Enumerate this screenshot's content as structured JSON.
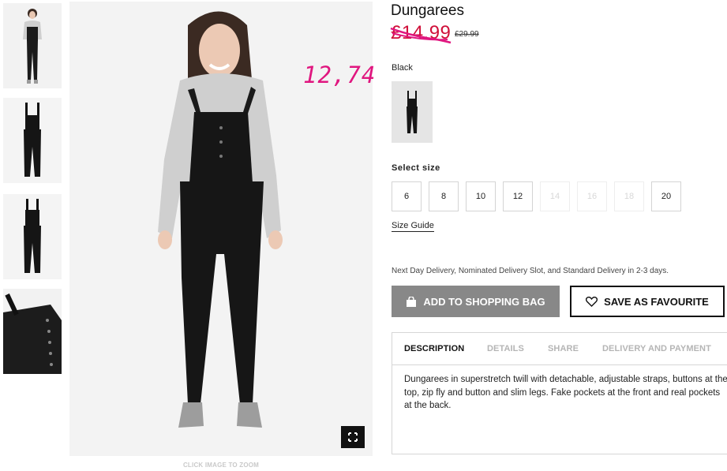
{
  "gallery": {
    "zoom_hint": "CLICK IMAGE TO ZOOM"
  },
  "annotation": "12,74",
  "product": {
    "title": "Dungarees",
    "price_sale": "£14.99",
    "price_original": "£29.99",
    "color_label": "Black",
    "size_label": "Select size",
    "sizes": [
      {
        "label": "6",
        "available": true
      },
      {
        "label": "8",
        "available": true
      },
      {
        "label": "10",
        "available": true
      },
      {
        "label": "12",
        "available": true
      },
      {
        "label": "14",
        "available": false
      },
      {
        "label": "16",
        "available": false
      },
      {
        "label": "18",
        "available": false
      },
      {
        "label": "20",
        "available": true
      }
    ],
    "size_guide": "Size Guide",
    "delivery": "Next Day Delivery, Nominated Delivery Slot, and Standard Delivery in 2-3 days."
  },
  "actions": {
    "add_to_bag": "ADD TO SHOPPING BAG",
    "save_favourite": "SAVE AS FAVOURITE",
    "bag_icon": "shopping-bag-icon",
    "heart_icon": "heart-icon"
  },
  "tabs": {
    "items": [
      "DESCRIPTION",
      "DETAILS",
      "SHARE",
      "DELIVERY AND PAYMENT"
    ],
    "active": "DESCRIPTION",
    "description_text": "Dungarees in superstretch twill with detachable, adjustable straps, buttons at the top, zip fly and button and slim legs. Fake pockets at the front and real pockets at the back."
  },
  "colors": {
    "sale_red": "#d0103a",
    "annotation_pink": "#e0167f",
    "bag_button": "#888888"
  }
}
